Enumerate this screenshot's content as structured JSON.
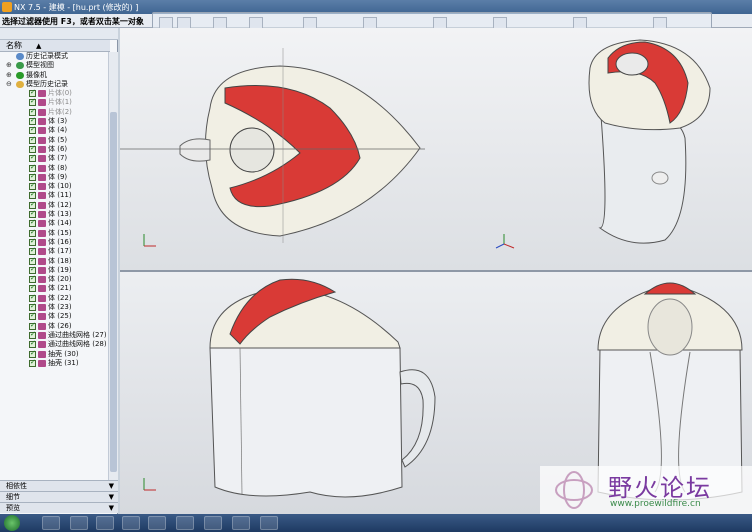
{
  "window": {
    "title": "NX 7.5 - 建模 - [hu.prt (修改的) ]"
  },
  "message": "选择过滤器使用 F3，或者双击某一对象",
  "nav": {
    "column_header": "名称",
    "top_items": [
      {
        "label": "历史记录模式",
        "expander": "",
        "icon_color": "#5a8ac8"
      },
      {
        "label": "模型视图",
        "expander": "⊕",
        "icon_color": "#3a9a4a"
      },
      {
        "label": "摄像机",
        "expander": "⊕",
        "icon_color": "#2a9a2a"
      },
      {
        "label": "模型历史记录",
        "expander": "⊖",
        "icon_color": "#e0b040"
      }
    ],
    "features": [
      {
        "label": "片体(0)",
        "dim": true
      },
      {
        "label": "片体(1)",
        "dim": true
      },
      {
        "label": "片体(2)",
        "dim": true
      },
      {
        "label": "体 (3)",
        "dim": false
      },
      {
        "label": "体 (4)",
        "dim": false
      },
      {
        "label": "体 (5)",
        "dim": false
      },
      {
        "label": "体 (6)",
        "dim": false
      },
      {
        "label": "体 (7)",
        "dim": false
      },
      {
        "label": "体 (8)",
        "dim": false
      },
      {
        "label": "体 (9)",
        "dim": false
      },
      {
        "label": "体 (10)",
        "dim": false
      },
      {
        "label": "体 (11)",
        "dim": false
      },
      {
        "label": "体 (12)",
        "dim": false
      },
      {
        "label": "体 (13)",
        "dim": false
      },
      {
        "label": "体 (14)",
        "dim": false
      },
      {
        "label": "体 (15)",
        "dim": false
      },
      {
        "label": "体 (16)",
        "dim": false
      },
      {
        "label": "体 (17)",
        "dim": false
      },
      {
        "label": "体 (18)",
        "dim": false
      },
      {
        "label": "体 (19)",
        "dim": false
      },
      {
        "label": "体 (20)",
        "dim": false
      },
      {
        "label": "体 (21)",
        "dim": false
      },
      {
        "label": "体 (22)",
        "dim": false
      },
      {
        "label": "体 (23)",
        "dim": false
      },
      {
        "label": "体 (25)",
        "dim": false
      },
      {
        "label": "体 (26)",
        "dim": false
      },
      {
        "label": "通过曲线网格 (27)",
        "dim": false
      },
      {
        "label": "通过曲线网格 (28)",
        "dim": false
      },
      {
        "label": "抽壳 (30)",
        "dim": false
      },
      {
        "label": "抽壳 (31)",
        "dim": false
      }
    ],
    "footer": [
      {
        "label": "相依性"
      },
      {
        "label": "细节"
      },
      {
        "label": "预览"
      }
    ]
  },
  "watermark": {
    "title": "野火论坛",
    "url": "www.proewildfire.cn"
  },
  "colors": {
    "shell": "#f4f2e8",
    "accent_red": "#d83434",
    "glass": "#e6e9ee"
  }
}
